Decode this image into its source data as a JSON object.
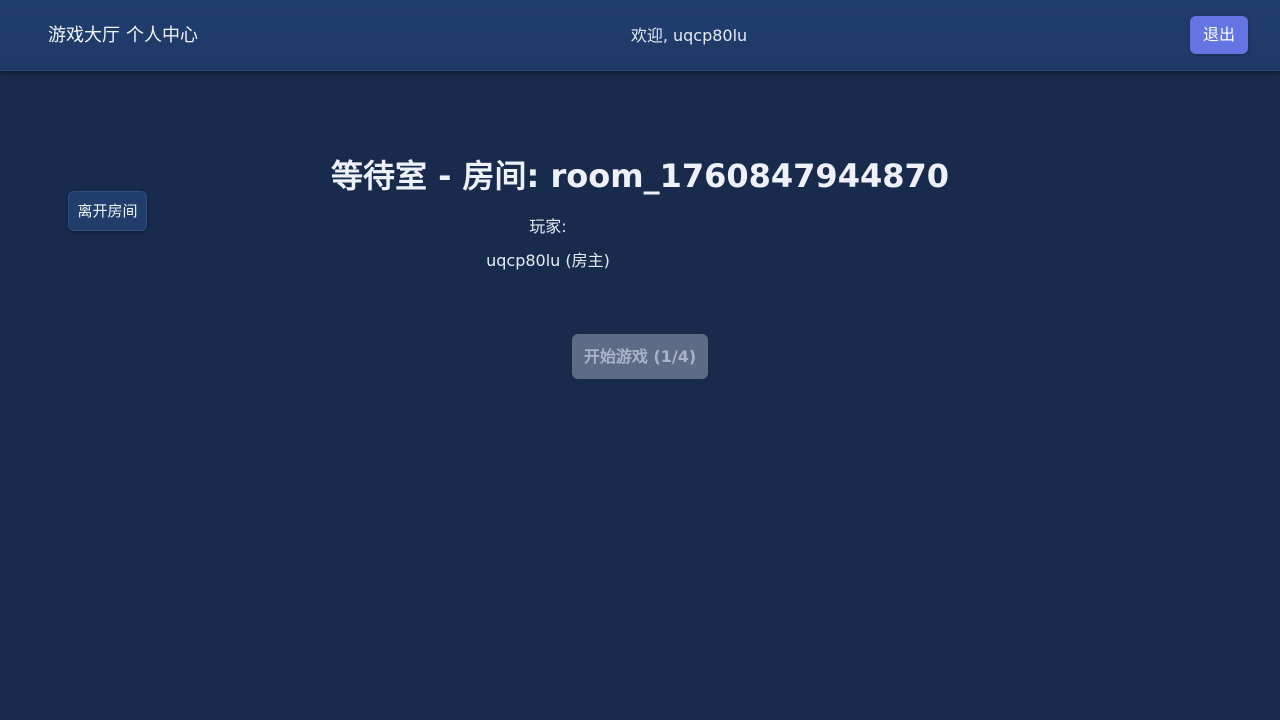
{
  "header": {
    "nav": [
      "游戏大厅",
      "个人中心"
    ],
    "welcome": "欢迎, uqcp80lu",
    "logout_label": "退出"
  },
  "room": {
    "leave_label": "离开房间",
    "title": "等待室 - 房间: room_1760847944870",
    "players_label": "玩家:",
    "players": [
      "uqcp80lu (房主)"
    ],
    "start_label": "开始游戏 (1/4)"
  },
  "colors": {
    "background": "#182b4c",
    "topbar": "#213d6e",
    "accent": "#6574e3",
    "disabled_button": "#5d6b87"
  }
}
